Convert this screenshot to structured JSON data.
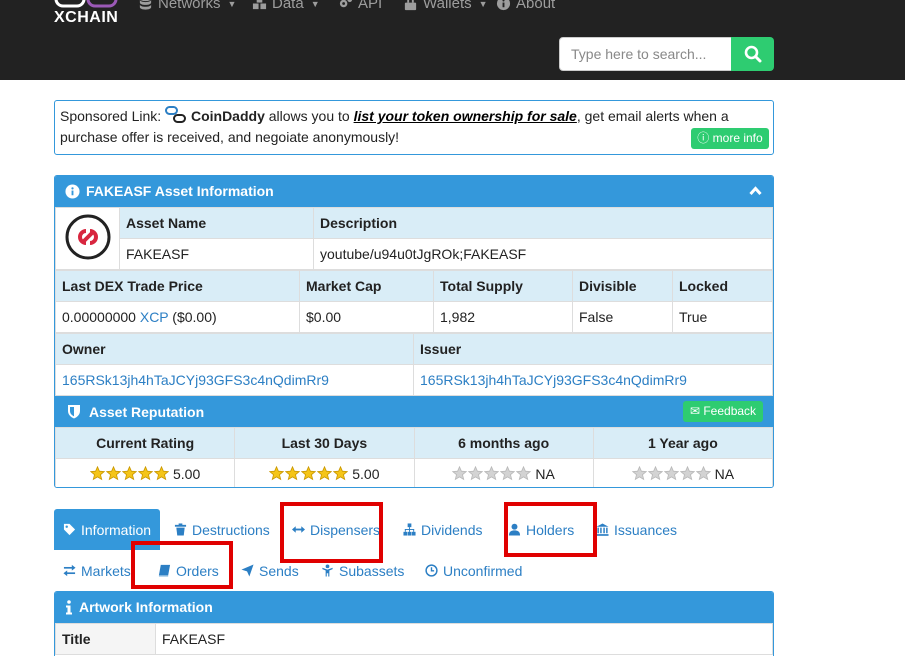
{
  "brand": {
    "name": "XCHAIN"
  },
  "nav": {
    "items": [
      {
        "label": "Networks"
      },
      {
        "label": "Data"
      },
      {
        "label": "API"
      },
      {
        "label": "Wallets"
      },
      {
        "label": "About"
      }
    ],
    "search_placeholder": "Type here to search..."
  },
  "sponsor": {
    "prefix": "Sponsored Link:",
    "brand": "CoinDaddy",
    "text1": "allows you to",
    "link": "list your token ownership for sale",
    "text2": ", get email alerts when a purchase offer is received, and negoiate anonymously!",
    "more_info": "more info"
  },
  "asset_panel": {
    "title": "FAKEASF Asset Information",
    "headers": {
      "asset_name": "Asset Name",
      "description": "Description",
      "last_dex_price": "Last DEX Trade Price",
      "market_cap": "Market Cap",
      "total_supply": "Total Supply",
      "divisible": "Divisible",
      "locked": "Locked",
      "owner": "Owner",
      "issuer": "Issuer"
    },
    "values": {
      "asset_name": "FAKEASF",
      "description": "youtube/u94u0tJgROk;FAKEASF",
      "price_amount": "0.00000000",
      "price_asset": "XCP",
      "price_usd": "($0.00)",
      "market_cap": "$0.00",
      "total_supply": "1,982",
      "divisible": "False",
      "locked": "True",
      "owner": "165RSk13jh4hTaJCYj93GFS3c4nQdimRr9",
      "issuer": "165RSk13jh4hTaJCYj93GFS3c4nQdimRr9"
    }
  },
  "reputation": {
    "title": "Asset Reputation",
    "feedback": "Feedback",
    "columns": [
      {
        "label": "Current Rating",
        "stars": 5,
        "value": "5.00"
      },
      {
        "label": "Last 30 Days",
        "stars": 5,
        "value": "5.00"
      },
      {
        "label": "6 months ago",
        "stars": 0,
        "value": "NA"
      },
      {
        "label": "1 Year ago",
        "stars": 0,
        "value": "NA"
      }
    ],
    "colors": {
      "star_filled": "#f5c518",
      "star_empty": "#d3d3d3"
    }
  },
  "tabs": {
    "row1": [
      {
        "label": "Information",
        "icon": "tag-icon",
        "active": true
      },
      {
        "label": "Destructions",
        "icon": "trash-icon"
      },
      {
        "label": "Dispensers",
        "icon": "arrows-h-icon"
      },
      {
        "label": "Dividends",
        "icon": "sitemap-icon"
      },
      {
        "label": "Holders",
        "icon": "user-icon"
      },
      {
        "label": "Issuances",
        "icon": "bank-icon"
      }
    ],
    "row2": [
      {
        "label": "Markets",
        "icon": "exchange-icon"
      },
      {
        "label": "Orders",
        "icon": "book-icon"
      },
      {
        "label": "Sends",
        "icon": "send-icon"
      },
      {
        "label": "Subassets",
        "icon": "child-icon"
      },
      {
        "label": "Unconfirmed",
        "icon": "clock-icon"
      }
    ]
  },
  "artwork": {
    "title": "Artwork Information",
    "rows": [
      {
        "label": "Title",
        "value": "FAKEASF"
      }
    ]
  },
  "colors": {
    "accent": "#3498db",
    "green": "#2ecc71",
    "navbar": "#222222",
    "highlight": "#e00000",
    "header_cell": "#d9edf7"
  }
}
